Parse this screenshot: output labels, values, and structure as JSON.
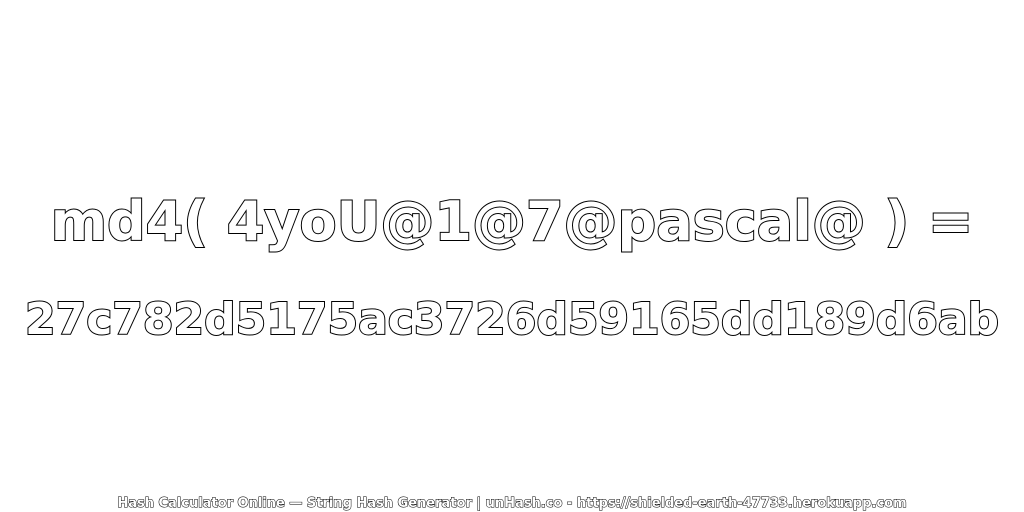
{
  "main": {
    "expression": "md4( 4yoU@1@7@pascal@ ) =",
    "hash": "27c782d5175ac3726d59165dd189d6ab"
  },
  "footer": {
    "text": "Hash Calculator Online — String Hash Generator | unHash.co - https://shielded-earth-47733.herokuapp.com"
  },
  "colors": {
    "background": "#ffffff",
    "text_fill": "#ffffff",
    "text_outline": "#000000"
  }
}
